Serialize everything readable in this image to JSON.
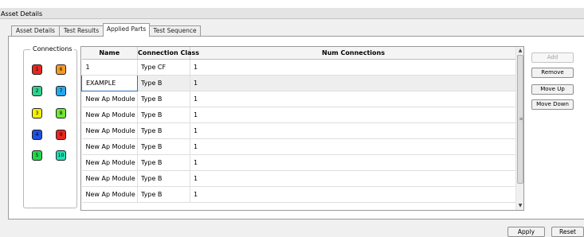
{
  "window": {
    "title": "Asset Details"
  },
  "tabs": [
    {
      "label": "Asset Details",
      "active": false
    },
    {
      "label": "Test Results",
      "active": false
    },
    {
      "label": "Applied Parts",
      "active": true
    },
    {
      "label": "Test Sequence",
      "active": false
    }
  ],
  "connections": {
    "legend": "Connections",
    "buttons": [
      {
        "label": "1",
        "color": "#e8261e"
      },
      {
        "label": "6",
        "color": "#f59a24"
      },
      {
        "label": "2",
        "color": "#30d090"
      },
      {
        "label": "7",
        "color": "#28a8e8"
      },
      {
        "label": "3",
        "color": "#f4f000"
      },
      {
        "label": "8",
        "color": "#70e830"
      },
      {
        "label": "4",
        "color": "#1e50e0"
      },
      {
        "label": "9",
        "color": "#e8261e"
      },
      {
        "label": "5",
        "color": "#22d84a"
      },
      {
        "label": "10",
        "color": "#1ee0b4"
      }
    ]
  },
  "table": {
    "columns": [
      "Name",
      "Connection Class",
      "Num Connections"
    ],
    "rows": [
      [
        "1",
        "Type CF",
        "1"
      ],
      [
        "EXAMPLE",
        "Type B",
        "1"
      ],
      [
        "New Ap Module",
        "Type B",
        "1"
      ],
      [
        "New Ap Module",
        "Type B",
        "1"
      ],
      [
        "New Ap Module",
        "Type B",
        "1"
      ],
      [
        "New Ap Module",
        "Type B",
        "1"
      ],
      [
        "New Ap Module",
        "Type B",
        "1"
      ],
      [
        "New Ap Module",
        "Type B",
        "1"
      ],
      [
        "New Ap Module",
        "Type B",
        "1"
      ]
    ],
    "selected_row": 1
  },
  "scrollbar": {
    "up_icon": "arrow-up-icon",
    "down_icon": "arrow-down-icon",
    "grip_icon": "grip-icon"
  },
  "actions": {
    "add": "Add",
    "remove": "Remove",
    "move_up": "Move Up",
    "move_down": "Move Down"
  },
  "footer": {
    "apply": "Apply",
    "reset": "Reset"
  }
}
